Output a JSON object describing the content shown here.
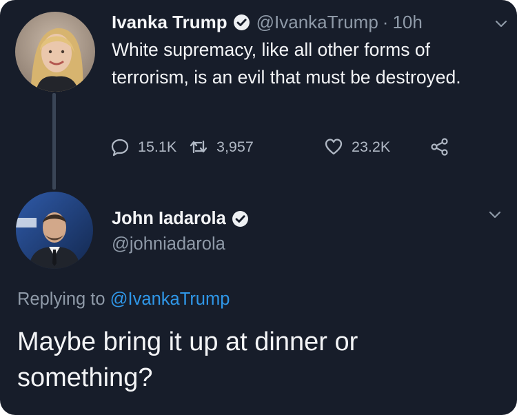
{
  "original_tweet": {
    "author_name": "Ivanka Trump",
    "handle": "@IvankaTrump",
    "separator": "·",
    "time": "10h",
    "text": "White supremacy, like all other forms of terrorism, is an evil that must be destroyed.",
    "replies": "15.1K",
    "retweets": "3,957",
    "likes": "23.2K",
    "icons": [
      "verified-icon",
      "chevron-down-icon",
      "reply-icon",
      "retweet-icon",
      "like-icon",
      "share-icon"
    ]
  },
  "reply_tweet": {
    "author_name": "John Iadarola",
    "handle": "@johniadarola",
    "replying_prefix": "Replying to",
    "replying_mention": "@IvankaTrump",
    "text": "Maybe bring it up at dinner or something?",
    "icons": [
      "verified-icon",
      "chevron-down-icon"
    ]
  },
  "colors": {
    "background": "#171d2a",
    "primary_text": "#f3f4f6",
    "secondary_text": "#8f9aa8",
    "mention": "#2f97e8",
    "thread_line": "#3a4556"
  }
}
